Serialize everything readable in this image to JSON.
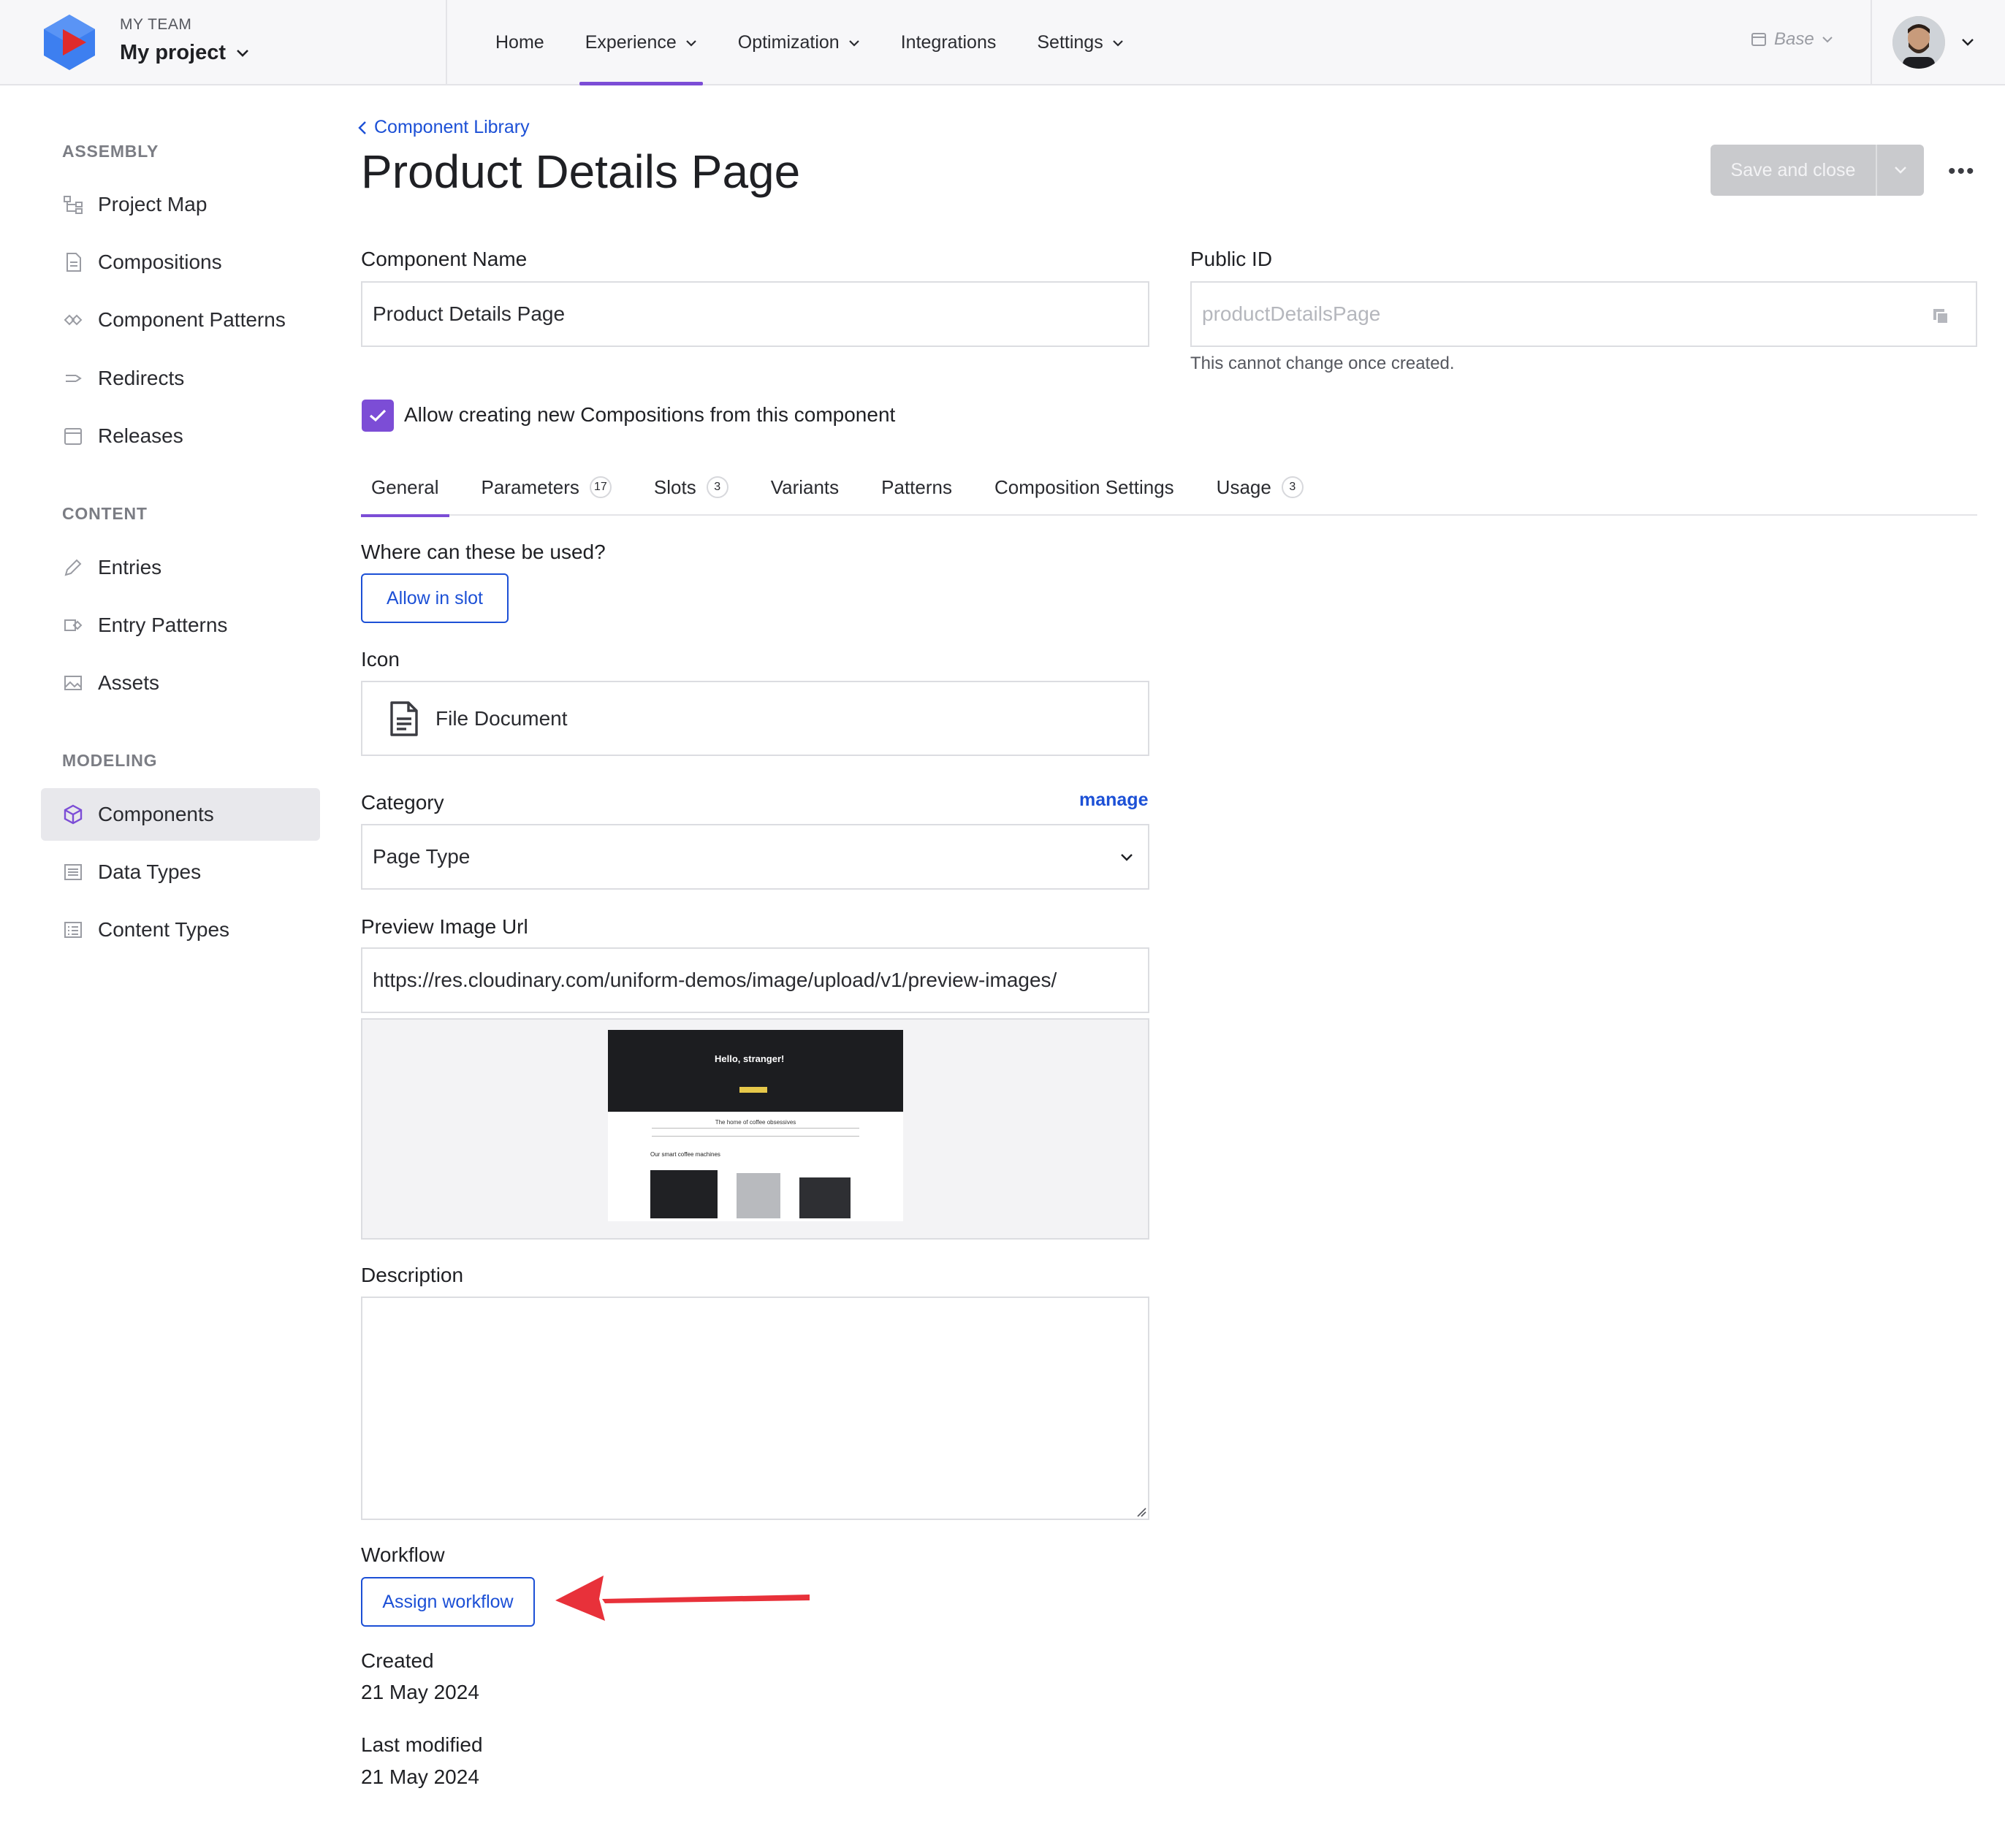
{
  "header": {
    "team": "MY TEAM",
    "project": "My project",
    "nav": [
      {
        "label": "Home",
        "dropdown": false
      },
      {
        "label": "Experience",
        "dropdown": true
      },
      {
        "label": "Optimization",
        "dropdown": true
      },
      {
        "label": "Integrations",
        "dropdown": false
      },
      {
        "label": "Settings",
        "dropdown": true
      }
    ],
    "active_nav": "Experience",
    "environment": "Base"
  },
  "sidebar": {
    "sections": [
      {
        "heading": "ASSEMBLY",
        "items": [
          "Project Map",
          "Compositions",
          "Component Patterns",
          "Redirects",
          "Releases"
        ]
      },
      {
        "heading": "CONTENT",
        "items": [
          "Entries",
          "Entry Patterns",
          "Assets"
        ]
      },
      {
        "heading": "MODELING",
        "items": [
          "Components",
          "Data Types",
          "Content Types"
        ]
      }
    ],
    "active_item": "Components"
  },
  "main": {
    "breadcrumb": "Component Library",
    "title": "Product Details Page",
    "save_label": "Save and close",
    "more_label": "•••",
    "component_name_label": "Component Name",
    "component_name_value": "Product Details Page",
    "public_id_label": "Public ID",
    "public_id_value": "productDetailsPage",
    "public_id_hint": "This cannot change once created.",
    "allow_compositions_label": "Allow creating new Compositions from this component",
    "tabs": [
      {
        "label": "General",
        "count": ""
      },
      {
        "label": "Parameters",
        "count": "17"
      },
      {
        "label": "Slots",
        "count": "3"
      },
      {
        "label": "Variants",
        "count": ""
      },
      {
        "label": "Patterns",
        "count": ""
      },
      {
        "label": "Composition Settings",
        "count": ""
      },
      {
        "label": "Usage",
        "count": "3"
      }
    ],
    "where_label": "Where can these be used?",
    "allow_slot_label": "Allow in slot",
    "icon_label": "Icon",
    "icon_value": "File Document",
    "category_label": "Category",
    "manage_label": "manage",
    "category_value": "Page Type",
    "preview_url_label": "Preview Image Url",
    "preview_url_value": "https://res.cloudinary.com/uniform-demos/image/upload/v1/preview-images/",
    "preview_thumb": {
      "hero_text": "Hello, stranger!",
      "subtitle": "The home of coffee obsessives",
      "section": "Our smart coffee machines"
    },
    "description_label": "Description",
    "workflow_label": "Workflow",
    "assign_workflow_label": "Assign workflow",
    "created_label": "Created",
    "created_value": "21 May 2024",
    "modified_label": "Last modified",
    "modified_value": "21 May 2024"
  },
  "colors": {
    "accent": "#7c4dd6",
    "link": "#1c50d6",
    "annotation_arrow": "#e8313a"
  }
}
